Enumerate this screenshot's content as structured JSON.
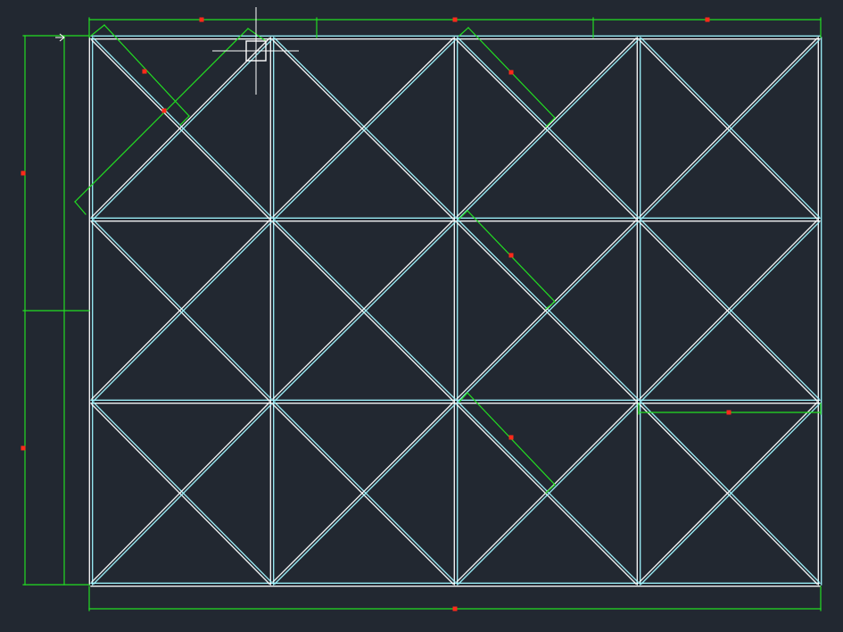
{
  "canvas": {
    "background": "#222831",
    "colors": {
      "frame": "#ffffff",
      "frame_alt": "#9ff6ff",
      "dimension": "#22dd22",
      "grip": "#ff2a1a",
      "cursor": "#ffffff"
    }
  },
  "drawing": {
    "grid_columns": 4,
    "grid_rows": 3,
    "each_bay": "x-braced",
    "dimension_lines": "green",
    "dimension_text_visible": false
  },
  "cursor": {
    "type": "crosshair-with-pickbox"
  },
  "icons": {
    "crosshair": "crosshair-icon",
    "pickbox": "pickbox-icon",
    "grip": "grip-icon"
  }
}
